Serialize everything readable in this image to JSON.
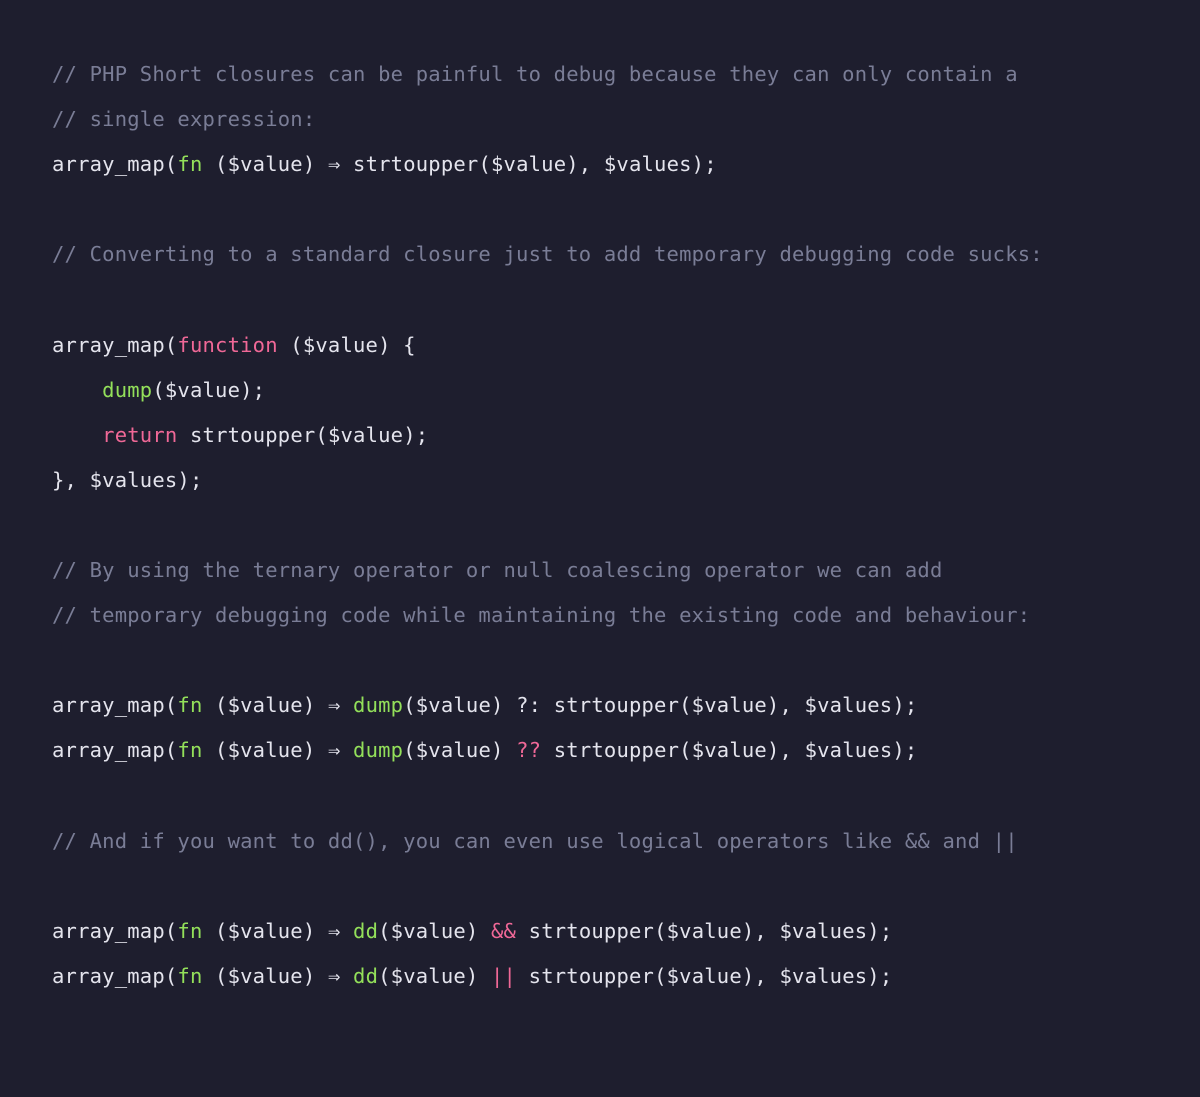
{
  "lines": [
    [
      {
        "cls": "c",
        "t": "// PHP Short closures can be painful to debug because they can only contain a"
      }
    ],
    [
      {
        "cls": "c",
        "t": "// single expression:"
      }
    ],
    [
      {
        "cls": "d",
        "t": "array_map("
      },
      {
        "cls": "fn",
        "t": "fn"
      },
      {
        "cls": "d",
        "t": " ($value) "
      },
      {
        "cls": "ar",
        "t": "⇒"
      },
      {
        "cls": "d",
        "t": " strtoupper($value), $values);"
      }
    ],
    [],
    [
      {
        "cls": "c",
        "t": "// Converting to a standard closure just to add temporary debugging code sucks:"
      }
    ],
    [],
    [
      {
        "cls": "d",
        "t": "array_map("
      },
      {
        "cls": "k",
        "t": "function"
      },
      {
        "cls": "d",
        "t": " ($value) {"
      }
    ],
    [
      {
        "cls": "d",
        "t": "    "
      },
      {
        "cls": "fn",
        "t": "dump"
      },
      {
        "cls": "d",
        "t": "($value);"
      }
    ],
    [
      {
        "cls": "d",
        "t": "    "
      },
      {
        "cls": "k",
        "t": "return"
      },
      {
        "cls": "d",
        "t": " strtoupper($value);"
      }
    ],
    [
      {
        "cls": "d",
        "t": "}, $values);"
      }
    ],
    [],
    [
      {
        "cls": "c",
        "t": "// By using the ternary operator or null coalescing operator we can add"
      }
    ],
    [
      {
        "cls": "c",
        "t": "// temporary debugging code while maintaining the existing code and behaviour:"
      }
    ],
    [],
    [
      {
        "cls": "d",
        "t": "array_map("
      },
      {
        "cls": "fn",
        "t": "fn"
      },
      {
        "cls": "d",
        "t": " ($value) "
      },
      {
        "cls": "ar",
        "t": "⇒"
      },
      {
        "cls": "d",
        "t": " "
      },
      {
        "cls": "fn",
        "t": "dump"
      },
      {
        "cls": "d",
        "t": "($value) ?: strtoupper($value), $values);"
      }
    ],
    [
      {
        "cls": "d",
        "t": "array_map("
      },
      {
        "cls": "fn",
        "t": "fn"
      },
      {
        "cls": "d",
        "t": " ($value) "
      },
      {
        "cls": "ar",
        "t": "⇒"
      },
      {
        "cls": "d",
        "t": " "
      },
      {
        "cls": "fn",
        "t": "dump"
      },
      {
        "cls": "d",
        "t": "($value) "
      },
      {
        "cls": "op",
        "t": "??"
      },
      {
        "cls": "d",
        "t": " strtoupper($value), $values);"
      }
    ],
    [],
    [
      {
        "cls": "c",
        "t": "// And if you want to dd(), you can even use logical operators like && and ||"
      }
    ],
    [],
    [
      {
        "cls": "d",
        "t": "array_map("
      },
      {
        "cls": "fn",
        "t": "fn"
      },
      {
        "cls": "d",
        "t": " ($value) "
      },
      {
        "cls": "ar",
        "t": "⇒"
      },
      {
        "cls": "d",
        "t": " "
      },
      {
        "cls": "fn",
        "t": "dd"
      },
      {
        "cls": "d",
        "t": "($value) "
      },
      {
        "cls": "op",
        "t": "&&"
      },
      {
        "cls": "d",
        "t": " strtoupper($value), $values);"
      }
    ],
    [
      {
        "cls": "d",
        "t": "array_map("
      },
      {
        "cls": "fn",
        "t": "fn"
      },
      {
        "cls": "d",
        "t": " ($value) "
      },
      {
        "cls": "ar",
        "t": "⇒"
      },
      {
        "cls": "d",
        "t": " "
      },
      {
        "cls": "fn",
        "t": "dd"
      },
      {
        "cls": "d",
        "t": "($value) "
      },
      {
        "cls": "op",
        "t": "||"
      },
      {
        "cls": "d",
        "t": " strtoupper($value), $values);"
      }
    ]
  ]
}
